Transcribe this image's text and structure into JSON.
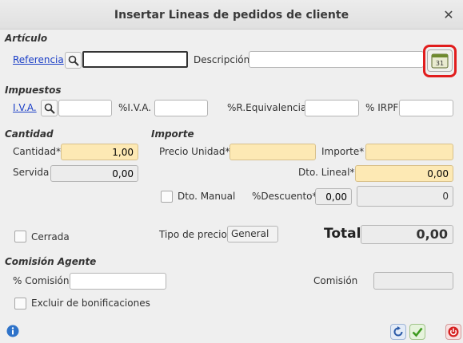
{
  "window": {
    "title": "Insertar Lineas de pedidos de cliente"
  },
  "articulo": {
    "section": "Artículo",
    "referencia_link": "Referencia",
    "referencia_value": "",
    "descripcion_label": "Descripción",
    "descripcion_value": "",
    "calendar_day": "31"
  },
  "impuestos": {
    "section": "Impuestos",
    "iva_link": "I.V.A.",
    "iva_value": "",
    "pct_iva_label": "%I.V.A.",
    "pct_iva_value": "",
    "pct_requiv_label": "%R.Equivalencia",
    "pct_requiv_value": "",
    "pct_irpf_label": "% IRPF",
    "pct_irpf_value": ""
  },
  "cantidad": {
    "section": "Cantidad",
    "cantidad_label": "Cantidad*",
    "cantidad_value": "1,00",
    "servida_label": "Servida",
    "servida_value": "0,00",
    "cerrada_label": "Cerrada"
  },
  "importe": {
    "section": "Importe",
    "precio_unidad_label": "Precio Unidad*",
    "precio_unidad_value": "",
    "importe_label": "Importe*",
    "importe_value": "",
    "dto_lineal_label": "Dto. Lineal*",
    "dto_lineal_value": "0,00",
    "dto_manual_label": "Dto. Manual",
    "pct_descuento_label": "%Descuento*",
    "pct_descuento_value": "0,00",
    "descuento_total_value": "0",
    "tipo_precio_label": "Tipo de precio",
    "tipo_precio_value": "General",
    "total_label": "Total",
    "total_value": "0,00"
  },
  "comision": {
    "section": "Comisión Agente",
    "pct_comision_label": "% Comisión",
    "pct_comision_value": "",
    "comision_label": "Comisión",
    "comision_value": "",
    "excluir_label": "Excluir de bonificaciones"
  },
  "colors": {
    "highlight": "#e11d1d",
    "required_field": "#fde9b4",
    "link": "#1a3ec7"
  }
}
